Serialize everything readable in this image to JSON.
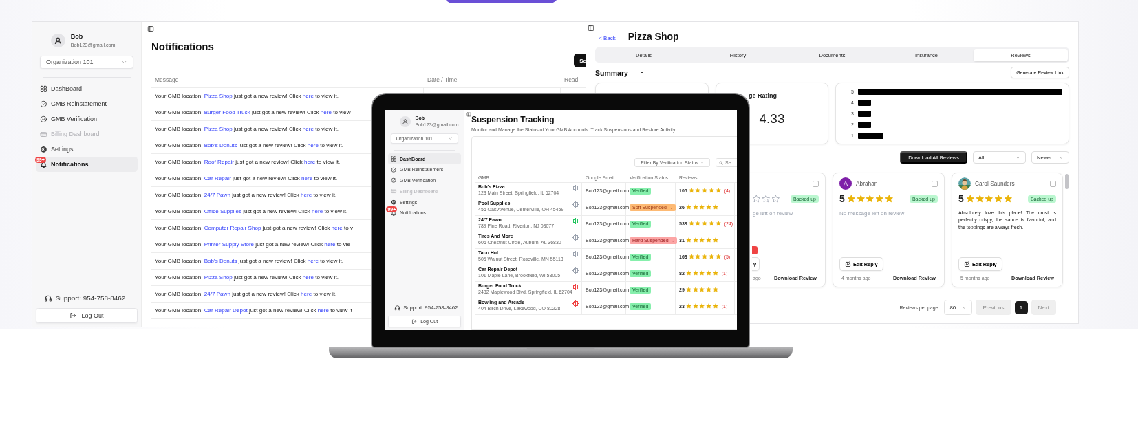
{
  "notifications_window": {
    "sidebar": {
      "user": {
        "name": "Bob",
        "email": "Bob123@gmail.com"
      },
      "organization": "Organization 101",
      "nav": [
        {
          "label": "DashBoard",
          "selected": false,
          "disabled": false
        },
        {
          "label": "GMB Reinstatement",
          "selected": false,
          "disabled": false
        },
        {
          "label": "GMB Verification",
          "selected": false,
          "disabled": false
        },
        {
          "label": "Billing Dashboard",
          "selected": false,
          "disabled": true
        },
        {
          "label": "Settings",
          "selected": false,
          "disabled": false
        },
        {
          "label": "Notifications",
          "selected": true,
          "disabled": false,
          "badge": "99+"
        }
      ],
      "support": "Support: 954-758-8462",
      "logout": "Log Out"
    },
    "title": "Notifications",
    "action_button": "Se",
    "columns": [
      "Message",
      "Date / Time",
      "Read"
    ],
    "rows": [
      {
        "before": "Your GMB location, ",
        "location": "Pizza Shop",
        "middle": " just got a new review! Click ",
        "link": "here",
        "after": " to view it."
      },
      {
        "before": "Your GMB location, ",
        "location": "Burger Food Truck",
        "middle": " just got a new review! Click ",
        "link": "here",
        "after": " to view"
      },
      {
        "before": "Your GMB location, ",
        "location": "Pizza Shop",
        "middle": " just got a new review! Click ",
        "link": "here",
        "after": " to view it."
      },
      {
        "before": "Your GMB location, ",
        "location": "Bob's Donuts",
        "middle": " just got a new review! Click ",
        "link": "here",
        "after": " to view it."
      },
      {
        "before": "Your GMB location, ",
        "location": "Roof Repair",
        "middle": " just got a new review! Click ",
        "link": "here",
        "after": " to view it."
      },
      {
        "before": "Your GMB location, ",
        "location": "Car Repair",
        "middle": " just got a new review! Click ",
        "link": "here",
        "after": " to view it."
      },
      {
        "before": "Your GMB location, ",
        "location": "24/7 Pawn",
        "middle": " just got a new review! Click ",
        "link": "here",
        "after": " to view it."
      },
      {
        "before": "Your GMB location, ",
        "location": "Office Supplies",
        "middle": " just got a new review! Click ",
        "link": "here",
        "after": " to view it."
      },
      {
        "before": "Your GMB location, ",
        "location": "Computer Repair Shop",
        "middle": " just got a new review! Click ",
        "link": "here",
        "after": " to v"
      },
      {
        "before": "Your GMB location, ",
        "location": "Printer Supply Store",
        "middle": " just got a new review! Click ",
        "link": "here",
        "after": " to vie"
      },
      {
        "before": "Your GMB location, ",
        "location": "Bob's Donuts",
        "middle": " just got a new review! Click ",
        "link": "here",
        "after": " to view it."
      },
      {
        "before": "Your GMB location, ",
        "location": "Pizza Shop",
        "middle": " just got a new review! Click ",
        "link": "here",
        "after": " to view it."
      },
      {
        "before": "Your GMB location, ",
        "location": "24/7 Pawn",
        "middle": " just got a new review! Click ",
        "link": "here",
        "after": " to view it."
      },
      {
        "before": "Your GMB location, ",
        "location": "Car Repair Depot",
        "middle": " just got a new review! Click ",
        "link": "here",
        "after": " to view it"
      }
    ]
  },
  "laptop_window": {
    "sidebar": {
      "user": {
        "name": "Bob",
        "email": "Bob123@gmail.com"
      },
      "organization": "Organization 101",
      "nav": [
        {
          "label": "DashBoard",
          "selected": true,
          "disabled": false
        },
        {
          "label": "GMB Reinstatement",
          "selected": false,
          "disabled": false
        },
        {
          "label": "GMB Verification",
          "selected": false,
          "disabled": false
        },
        {
          "label": "Billing Dashboard",
          "selected": false,
          "disabled": true
        },
        {
          "label": "Settings",
          "selected": false,
          "disabled": false
        },
        {
          "label": "Notifications",
          "selected": false,
          "disabled": false,
          "badge": "99+"
        }
      ],
      "support": "Support: 954-758-8462",
      "logout": "Log Out"
    },
    "title": "Suspension Tracking",
    "subtitle": "Monitor and Manage the Status of Your GMB Accounts: Track Suspensions and Restore Activity.",
    "filter": "Filter By Verification Status",
    "search_placeholder": "Se",
    "columns": [
      "GMB",
      "Google Email",
      "Verification Status",
      "Reviews"
    ],
    "rows": [
      {
        "name": "Bob's Pizza",
        "address": "123 Main Street, Springfield, IL 62704",
        "color": "#9ca3af",
        "email": "Bob123@gmail.com",
        "status": "Verified",
        "kind": "verified",
        "count": "105",
        "stars": 5,
        "new": "(4)"
      },
      {
        "name": "Pool Supplies",
        "address": "456 Oak Avenue, Centerville, OH 45459",
        "color": "#9ca3af",
        "email": "Bob123@gmail.com",
        "status": "Soft Suspended →",
        "kind": "soft",
        "count": "26",
        "stars": 5
      },
      {
        "name": "24/7 Pawn",
        "address": "789 Pine Road, Riverton, NJ 08077",
        "color": "#22c55e",
        "email": "Bob123@gmail.com",
        "status": "Verified",
        "kind": "verified",
        "count": "533",
        "stars": 5,
        "new": "(24)"
      },
      {
        "name": "Tires And More",
        "address": "606 Chestnut Circle, Auburn, AL 36830",
        "color": "#9ca3af",
        "email": "Bob123@gmail.com",
        "status": "Hard Suspended →",
        "kind": "hard",
        "count": "31",
        "stars": 5
      },
      {
        "name": "Taco Hut",
        "address": "505 Walnut Street, Roseville, MN 55113",
        "color": "#9ca3af",
        "email": "Bob123@gmail.com",
        "status": "Verified",
        "kind": "verified",
        "count": "168",
        "stars": 5,
        "new": "(5)"
      },
      {
        "name": "Car Repair Depot",
        "address": "101 Maple Lane, Brookfield, WI 53005",
        "color": "#9ca3af",
        "email": "Bob123@gmail.com",
        "status": "Verified",
        "kind": "verified",
        "count": "82",
        "stars": 5,
        "new": "(1)"
      },
      {
        "name": "Burger Food Truck",
        "address": "2432 Maplewood Blvd, Springfield, IL 62704",
        "color": "#ef4444",
        "email": "Bob123@gmail.com",
        "status": "Verified",
        "kind": "verified",
        "count": "29",
        "stars": 5
      },
      {
        "name": "Bowling and Arcade",
        "address": "404 Birch Drive, Lakewood, CO 80228",
        "color": "#ef4444",
        "email": "Bob123@gmail.com",
        "status": "Verified",
        "kind": "verified",
        "count": "23",
        "stars": 5,
        "new": "(1)"
      }
    ]
  },
  "reviews_window": {
    "back": "< Back",
    "title": "Pizza Shop",
    "tabs": [
      {
        "label": "Details",
        "selected": false
      },
      {
        "label": "History",
        "selected": false
      },
      {
        "label": "Documents",
        "selected": false
      },
      {
        "label": "Insurance",
        "selected": false
      },
      {
        "label": "Reviews",
        "selected": true
      }
    ],
    "summary": {
      "title": "Summary",
      "expanded": true,
      "generate_button": "Generate Review Link",
      "rating_title": "ge Rating",
      "rating_value": "4.33",
      "distribution_labels": [
        "5",
        "4",
        "3",
        "2",
        "1"
      ]
    },
    "toolbar": {
      "download_all": "Download All Reviews",
      "filter": "All",
      "sort": "Newer"
    },
    "reviews": [
      {
        "kind": "partial",
        "checked": false,
        "stars": 0,
        "badge": "Backed up",
        "message": "ge left on review",
        "has_message": false,
        "button": "y",
        "time": "ago",
        "download": "Download Review"
      },
      {
        "kind": "full",
        "avatar": {
          "kind": "letter",
          "letter": "A",
          "color": "#7e1fa8"
        },
        "name": "Abrahan",
        "checked": false,
        "rating": "5",
        "stars": 5,
        "badge": "Backed up",
        "message": "No message left on review",
        "has_message": false,
        "button": "Edit Reply",
        "time": "4 months ago",
        "download": "Download Review"
      },
      {
        "kind": "full",
        "name": "Carol Saunders",
        "checked": false,
        "rating": "5",
        "stars": 5,
        "badge": "Backed up",
        "message": "Absolutely love this place! The crust is perfectly crispy, the sauce is flavorful, and the toppings are always fresh.",
        "has_message": true,
        "button": "Edit Reply",
        "time": "5 months ago",
        "download": "Download Review"
      }
    ],
    "pagination": {
      "per_page_label": "Reviews per page:",
      "per_page": "80",
      "previous": "Previous",
      "pages": [
        {
          "label": "1",
          "selected": true
        }
      ],
      "next": "Next"
    }
  }
}
